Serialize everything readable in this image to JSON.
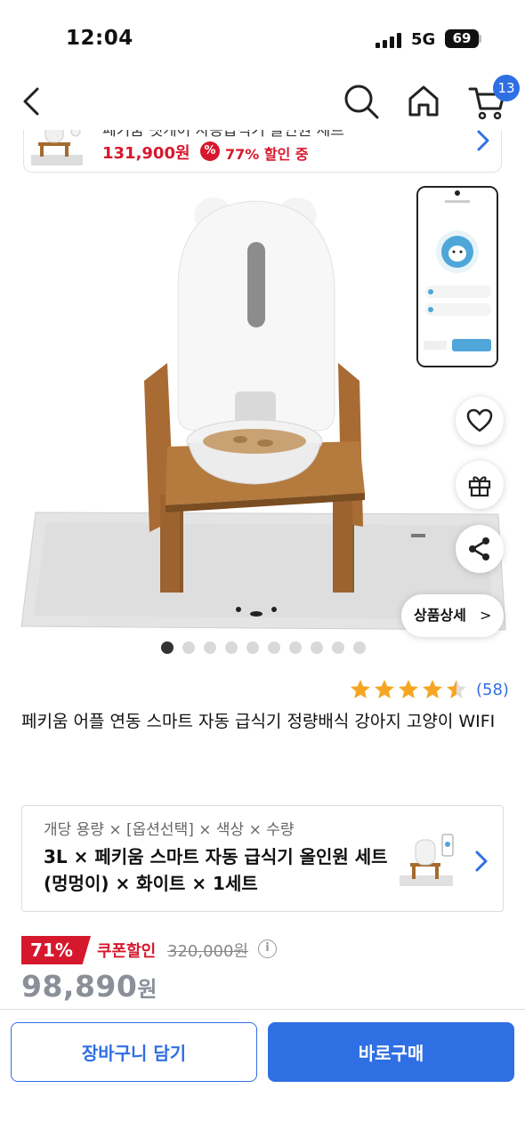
{
  "status_bar": {
    "time": "12:04",
    "network": "5G",
    "battery": "69"
  },
  "nav": {
    "cart_count": "13"
  },
  "mini_banner": {
    "title": "페키움 펫케어 자동급식기 올인원 세트",
    "price": "131,900원",
    "discount_icon": "%",
    "discount": "77% 할인 중"
  },
  "gallery": {
    "total_images": 10,
    "active_index": 0
  },
  "side_actions": {
    "detail_label": "상품상세",
    "detail_chevron": ">"
  },
  "rating": {
    "stars": 4.5,
    "count": "(58)"
  },
  "product": {
    "title": "페키움 어플 연동 스마트 자동 급식기 정량배식 강아지 고양이 WIFI"
  },
  "option": {
    "labels": "개당 용량 × [옵션선택] × 색상 × 수량",
    "value": "3L × 페키움 스마트 자동 급식기 올인원 세트(멍멍이) × 화이트 × 1세트"
  },
  "price": {
    "discount_rate": "71%",
    "coupon_label": "쿠폰할인",
    "original": "320,000원",
    "info_icon": "i",
    "final": "98,890",
    "final_unit": "원"
  },
  "actions": {
    "cart": "장바구니 담기",
    "buy": "바로구매"
  },
  "colors": {
    "accent": "#2f6fe4",
    "sale": "#d6182d",
    "star": "#f5a623"
  }
}
